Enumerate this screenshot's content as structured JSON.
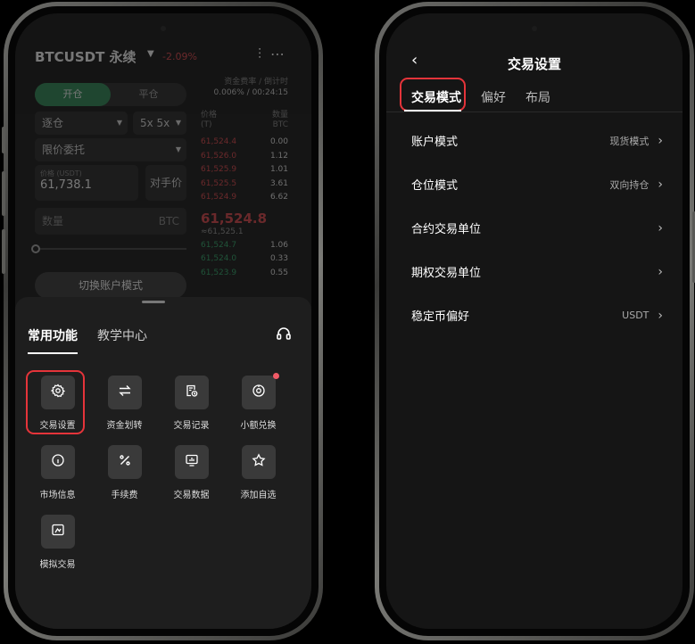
{
  "left": {
    "pair": "BTCUSDT 永续",
    "change": "-2.09%",
    "trade_tabs": [
      "开仓",
      "平仓"
    ],
    "margin_mode": "逐仓",
    "leverage": "5x  5x",
    "order_type": "限价委托",
    "price_label": "价格 (USDT)",
    "price_value": "61,738.1",
    "counter_price": "对手价",
    "qty_placeholder": "数量",
    "qty_unit": "BTC",
    "switch_account": "切换账户模式",
    "orderbook": {
      "funding": "资金费率 / 倒计时",
      "funding_value": "0.006% / 00:24:15",
      "col_price": "价格\n(T)",
      "col_qty": "数量\nBTC",
      "asks": [
        [
          "61,524.4",
          "0.00"
        ],
        [
          "61,526.0",
          "1.12"
        ],
        [
          "61,525.9",
          "1.01"
        ],
        [
          "61,525.5",
          "3.61"
        ],
        [
          "61,524.9",
          "6.62"
        ]
      ],
      "mid": "61,524.8",
      "mid_sub": "≈61,525.1",
      "bids": [
        [
          "61,524.7",
          "1.06"
        ],
        [
          "61,524.0",
          "0.33"
        ],
        [
          "61,523.9",
          "0.55"
        ]
      ]
    },
    "sheet": {
      "tab_active": "常用功能",
      "tab_other": "教学中心",
      "items": [
        {
          "label": "交易设置",
          "icon": "gear-icon"
        },
        {
          "label": "资金划转",
          "icon": "transfer-icon"
        },
        {
          "label": "交易记录",
          "icon": "record-icon"
        },
        {
          "label": "小额兑换",
          "icon": "exchange-icon"
        },
        {
          "label": "市场信息",
          "icon": "info-icon"
        },
        {
          "label": "手续费",
          "icon": "percent-icon"
        },
        {
          "label": "交易数据",
          "icon": "data-icon"
        },
        {
          "label": "添加自选",
          "icon": "star-icon"
        },
        {
          "label": "模拟交易",
          "icon": "simulate-icon"
        }
      ]
    }
  },
  "right": {
    "title": "交易设置",
    "tabs": [
      "交易模式",
      "偏好",
      "布局"
    ],
    "rows": [
      {
        "label": "账户模式",
        "value": "现货模式"
      },
      {
        "label": "仓位模式",
        "value": "双向持仓"
      },
      {
        "label": "合约交易单位",
        "value": ""
      },
      {
        "label": "期权交易单位",
        "value": ""
      },
      {
        "label": "稳定币偏好",
        "value": "USDT"
      }
    ]
  },
  "colors": {
    "accent_red": "#e5343a",
    "green": "#2e8b57",
    "ask_red": "#e0454a"
  }
}
